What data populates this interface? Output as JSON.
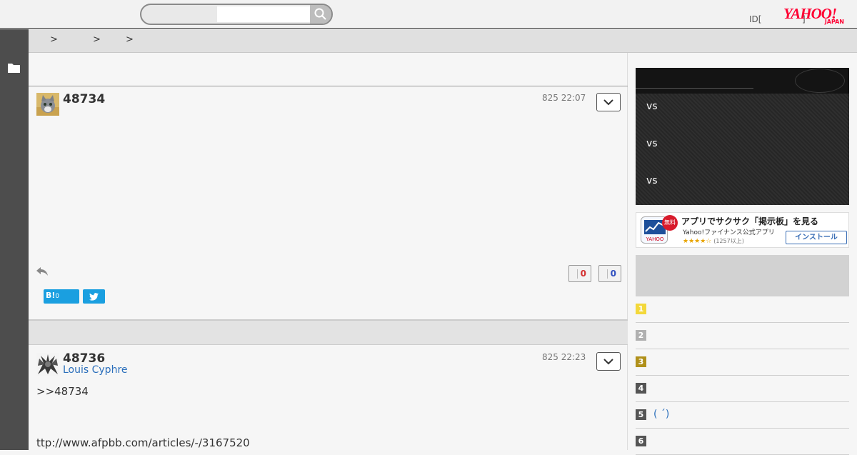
{
  "header": {
    "search_placeholder": "",
    "id_link": "ID[",
    "id_bracket": "]",
    "logo_text": "YAHOO!",
    "logo_sub": "JAPAN"
  },
  "breadcrumb": {
    "separators": [
      ">",
      ">",
      ">"
    ]
  },
  "posts": [
    {
      "number": "48734",
      "user": "",
      "date": "825 22:07",
      "body": [],
      "votes_good": "0",
      "votes_bad": "0",
      "hatena_label": "B!",
      "hatena_count": "0"
    },
    {
      "number": "48736",
      "user": "Louis Cyphre",
      "date": "825 22:23",
      "body": [
        ">>48734",
        "ttp://www.afpbb.com/articles/-/3167520"
      ]
    }
  ],
  "scores": {
    "rows": [
      "vs",
      "vs",
      "vs"
    ]
  },
  "ad": {
    "badge": "無料",
    "title": "アプリでサクサク「掲示板」を見る",
    "subtitle": "Yahoo!ファイナンス公式アプリ",
    "stars": "★★★★☆",
    "reviews": "(1257以上)",
    "install": "インストール"
  },
  "ranking": [
    {
      "rank": "1",
      "title": "",
      "color": "#f3d83a"
    },
    {
      "rank": "2",
      "title": "",
      "color": "#b0b0b0"
    },
    {
      "rank": "3",
      "title": "",
      "color": "#b0901a"
    },
    {
      "rank": "4",
      "title": "",
      "color": "#555555"
    },
    {
      "rank": "5",
      "title": "( ´)",
      "color": "#555555"
    },
    {
      "rank": "6",
      "title": "",
      "color": "#555555"
    }
  ]
}
